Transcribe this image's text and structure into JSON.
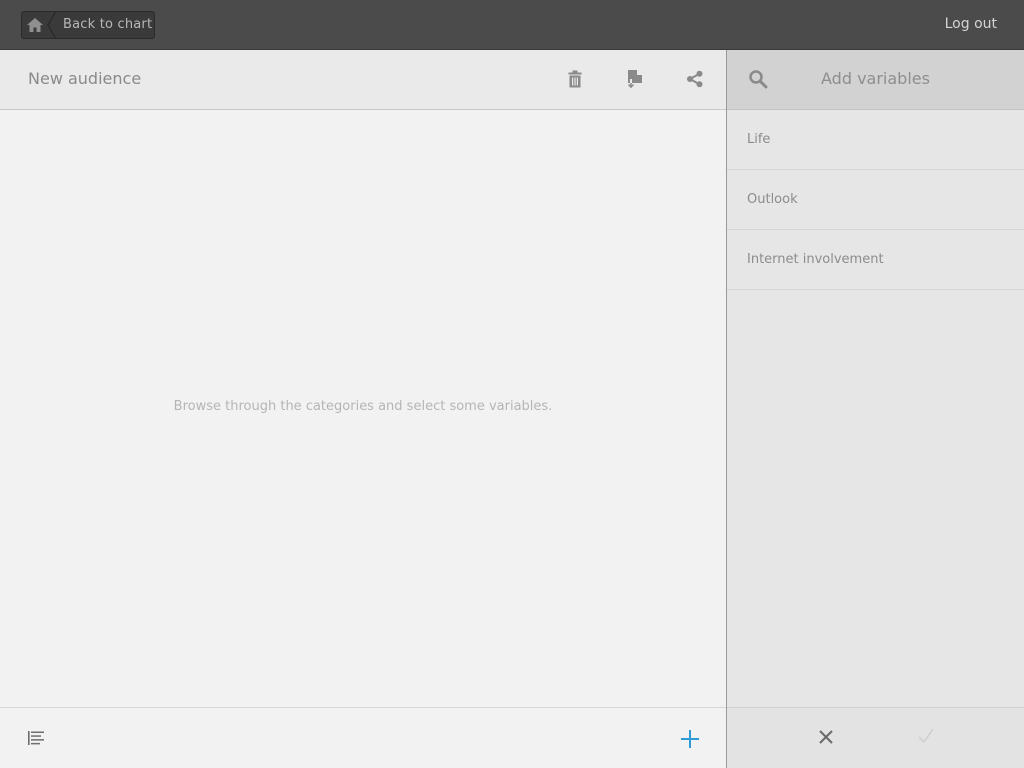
{
  "topbar": {
    "back_label": "Back to chart",
    "logout_label": "Log out",
    "home_icon": "home-icon"
  },
  "audience": {
    "title": "New audience",
    "empty_message": "Browse through the categories and select some variables.",
    "icons": [
      "trash-icon",
      "export-icon",
      "share-icon"
    ],
    "footer_icons": [
      "list-icon",
      "plus-icon"
    ],
    "accent_color": "#2f9bd6"
  },
  "variables": {
    "title": "Add variables",
    "search_icon": "search-icon",
    "items": [
      {
        "label": "Life"
      },
      {
        "label": "Outlook"
      },
      {
        "label": "Internet involvement"
      }
    ],
    "footer_icons": [
      "close-icon",
      "check-icon"
    ]
  },
  "colors": {
    "topbar": "#4b4b4b",
    "left_panel": "#f2f2f2",
    "right_panel": "#e6e6e6"
  }
}
